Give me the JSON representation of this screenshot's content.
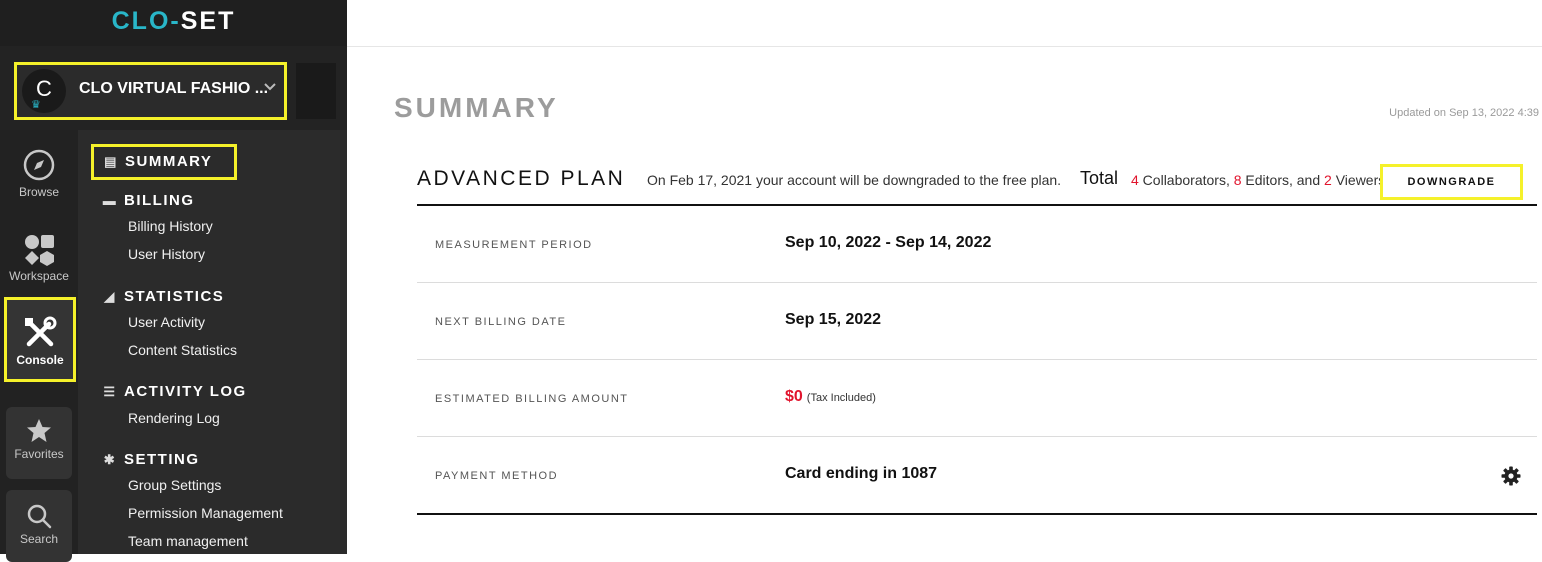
{
  "logo": {
    "part1": "CLO",
    "sep": "-",
    "part2": "SET"
  },
  "org": {
    "initial": "C",
    "name": "CLO VIRTUAL FASHIO ...",
    "crown_icon": "crown-icon",
    "chevron_icon": "chevron-down-icon"
  },
  "rail": {
    "browse": "Browse",
    "workspace": "Workspace",
    "console": "Console",
    "favorites": "Favorites",
    "search": "Search"
  },
  "menu": {
    "summary": "SUMMARY",
    "billing": "BILLING",
    "billing_history": "Billing History",
    "user_history": "User History",
    "statistics": "STATISTICS",
    "user_activity": "User Activity",
    "content_statistics": "Content Statistics",
    "activity_log": "ACTIVITY LOG",
    "rendering_log": "Rendering Log",
    "setting": "SETTING",
    "group_settings": "Group Settings",
    "permission_management": "Permission Management",
    "team_management": "Team management"
  },
  "main": {
    "title": "SUMMARY",
    "updated": "Updated on Sep 13, 2022 4:39",
    "plan": {
      "name": "ADVANCED PLAN",
      "notice": "On Feb 17, 2021 your account will be downgraded to the free plan.",
      "total_label": "Total",
      "collaborators_count": "4",
      "collaborators_label": " Collaborators, ",
      "editors_count": "8",
      "editors_label": " Editors, and ",
      "viewers_count": "2",
      "viewers_label": " Viewers",
      "downgrade_button": "DOWNGRADE"
    },
    "rows": {
      "measurement_label": "MEASUREMENT PERIOD",
      "measurement_value": "Sep 10, 2022 - Sep 14, 2022",
      "next_billing_label": "NEXT BILLING DATE",
      "next_billing_value": "Sep 15, 2022",
      "estimated_label": "ESTIMATED BILLING AMOUNT",
      "estimated_value": "$0",
      "estimated_note": "(Tax Included)",
      "payment_label": "PAYMENT METHOD",
      "payment_value": "Card ending in 1087"
    }
  },
  "colors": {
    "accent": "#29b6c8",
    "highlight": "#f5f12a",
    "alert": "#e1142d",
    "sidebar": "#2b2b2b"
  }
}
